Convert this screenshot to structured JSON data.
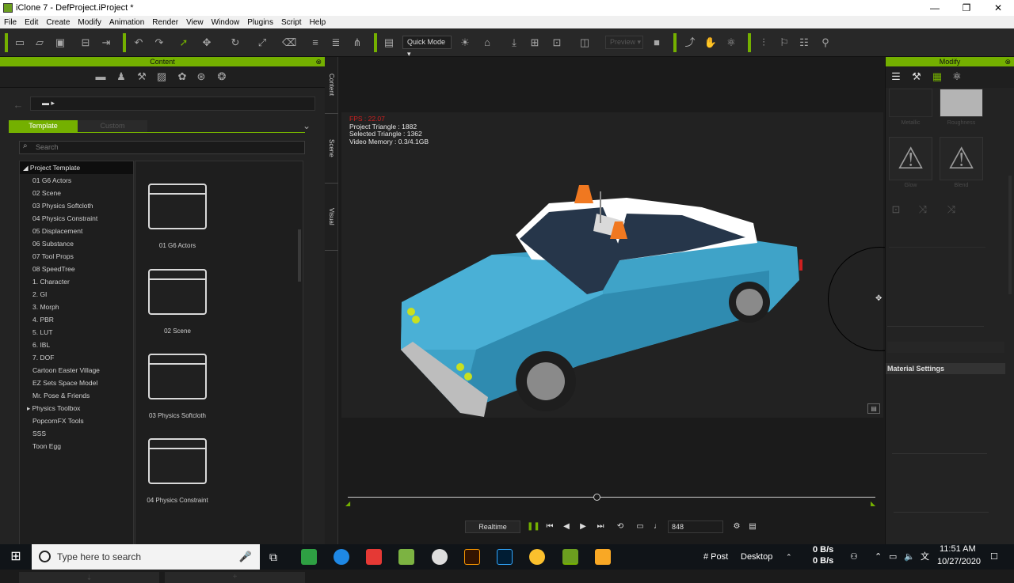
{
  "window": {
    "title": "iClone 7 - DefProject.iProject *",
    "controls": [
      "—",
      "❐",
      "✕"
    ]
  },
  "menu": [
    "File",
    "Edit",
    "Create",
    "Modify",
    "Animation",
    "Render",
    "View",
    "Window",
    "Plugins",
    "Script",
    "Help"
  ],
  "toolbar": {
    "quick_mode": "Quick Mode ▾",
    "preview": "Preview ▾"
  },
  "content_panel": {
    "title": "Content",
    "tab_template": "Template",
    "tab_custom": "Custom",
    "search_placeholder": "Search",
    "tree": [
      "Project Template",
      "01 G6 Actors",
      "02 Scene",
      "03 Physics Softcloth",
      "04 Physics Constraint",
      "05 Displacement",
      "06 Substance",
      "07 Tool Props",
      "08 SpeedTree",
      "1. Character",
      "2. GI",
      "3. Morph",
      "4. PBR",
      "5. LUT",
      "6. IBL",
      "7. DOF",
      "Cartoon Easter Village",
      "EZ Sets Space Model",
      "Mr. Pose & Friends",
      "Physics Toolbox",
      "PopcornFX Tools",
      "SSS",
      "Toon Egg"
    ],
    "folders": [
      "01 G6 Actors",
      "02 Scene",
      "03 Physics Softcloth",
      "04 Physics Constraint"
    ]
  },
  "side_tabs": [
    "Content",
    "Scene",
    "Visual"
  ],
  "viewport": {
    "hud": {
      "fps": "FPS : 22.07",
      "project_triangle": "Project Triangle : 1882",
      "selected_triangle": "Selected Triangle : 1362",
      "video_memory": "Video Memory : 0.3/4.1GB"
    },
    "playback": {
      "mode": "Realtime",
      "frame": "848"
    }
  },
  "modify_panel": {
    "title": "Modify",
    "swatches": [
      "Metallic",
      "Roughness",
      "Glow",
      "Blend"
    ],
    "material_settings": "Material Settings"
  },
  "taskbar": {
    "search_placeholder": "Type here to search",
    "post": "# Post",
    "desktop": "Desktop",
    "net_up": "0 B/s",
    "net_down": "0 B/s",
    "time": "11:51 AM",
    "date": "10/27/2020"
  }
}
